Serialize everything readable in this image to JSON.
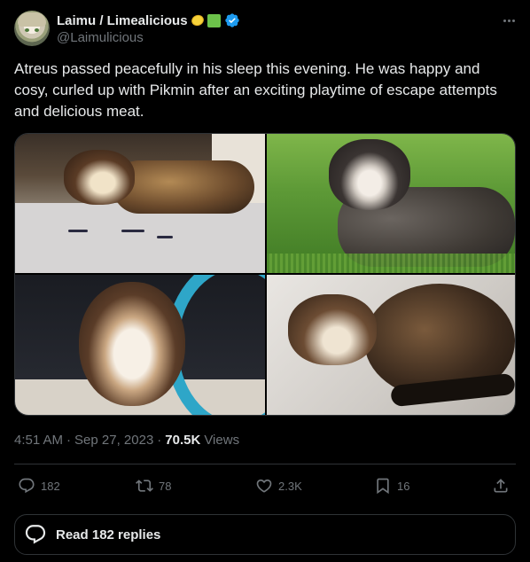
{
  "author": {
    "display_name": "Laimu / Limealicious",
    "handle": "@Laimulicious",
    "emoji": [
      "lemon-emoji",
      "green-square-emoji"
    ],
    "verified": true,
    "verified_color": "#1d9bf0"
  },
  "post": {
    "text": "Atreus passed peacefully in his sleep this evening. He was happy and cosy, curled up with Pikmin after an exciting playtime of escape attempts and delicious meat.",
    "photos": [
      "ferret-on-cushion-photo",
      "ferret-in-grass-photo",
      "ferret-in-tunnel-photo",
      "sleeping-ferret-photo"
    ]
  },
  "meta": {
    "time": "4:51 AM",
    "separator": "·",
    "date": "Sep 27, 2023",
    "views_count": "70.5K",
    "views_label": "Views"
  },
  "actions": {
    "replies": "182",
    "reposts": "78",
    "likes": "2.3K",
    "bookmarks": "16"
  },
  "read_replies_label": "Read 182 replies",
  "colors": {
    "background": "#000000",
    "text": "#e7e9ea",
    "muted": "#71767b",
    "border": "#2f3336",
    "accent": "#1d9bf0"
  }
}
